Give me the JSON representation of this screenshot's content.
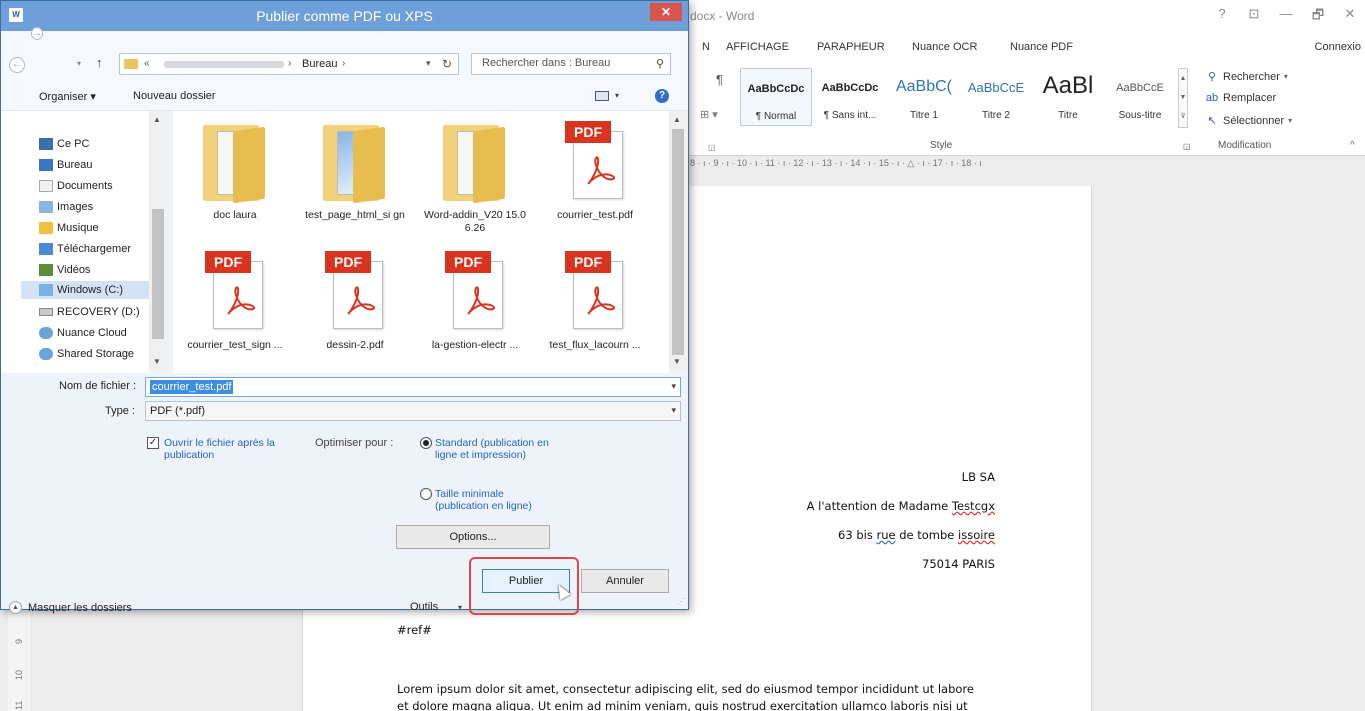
{
  "word": {
    "title": "docx - Word",
    "window_controls": [
      "?",
      "⊡",
      "—",
      "🗗",
      "✕"
    ],
    "tabs": [
      "N",
      "AFFICHAGE",
      "PARAPHEUR",
      "Nuance OCR",
      "Nuance PDF"
    ],
    "connexion": "Connexio",
    "paragraph_mark": "¶",
    "styles": [
      {
        "preview": "AaBbCcDc",
        "name": "¶ Normal"
      },
      {
        "preview": "AaBbCcDc",
        "name": "¶ Sans int..."
      },
      {
        "preview": "AaBbC(",
        "name": "Titre 1"
      },
      {
        "preview": "AaBbCcE",
        "name": "Titre 2"
      },
      {
        "preview": "AaBl",
        "name": "Titre"
      },
      {
        "preview": "AaBbCcE",
        "name": "Sous-titre"
      }
    ],
    "style_group_label": "Style",
    "modification": {
      "rechercher": "Rechercher",
      "remplacer": "Remplacer",
      "selectionner": "Sélectionner",
      "group_label": "Modification"
    },
    "ruler": "8 · ı · 9 · ı · 10 · ı · 11 · ı · 12 · ı · 13 · ı · 14 · ı · 15 · ı · △ · ı · 17 · ı · 18 · ı",
    "vruler": [
      "9",
      "10",
      "11"
    ],
    "document": {
      "company": "LB SA",
      "attention_prefix": "A l'attention de Madame ",
      "attention_name": "Testcgx",
      "addr_num": "63 bis ",
      "addr_rue": "rue",
      "addr_mid": " de tombe ",
      "addr_issoire": "issoire",
      "city": "75014 PARIS",
      "ref": "#ref#",
      "lorem1": "Lorem ipsum dolor sit amet, consectetur adipiscing elit, sed do eiusmod tempor incididunt ut labore",
      "lorem2": "et dolore magna aliqua. Ut enim ad minim veniam, quis nostrud exercitation ullamco laboris nisi ut"
    }
  },
  "dialog": {
    "title": "Publier comme PDF ou XPS",
    "close": "✕",
    "address": {
      "chevron": "«",
      "folder": "Bureau",
      "sep": "›"
    },
    "search_placeholder": "Rechercher dans : Bureau",
    "toolbar": {
      "organiser": "Organiser ▾",
      "nouveau_dossier": "Nouveau dossier",
      "help": "?"
    },
    "nav_items": [
      {
        "label": "Ce PC",
        "icon": "computer-icon"
      },
      {
        "label": "Bureau",
        "icon": "desktop-icon"
      },
      {
        "label": "Documents",
        "icon": "documents-icon"
      },
      {
        "label": "Images",
        "icon": "images-icon"
      },
      {
        "label": "Musique",
        "icon": "music-icon"
      },
      {
        "label": "Téléchargemer",
        "icon": "downloads-icon"
      },
      {
        "label": "Vidéos",
        "icon": "videos-icon"
      },
      {
        "label": "Windows (C:)",
        "icon": "windows-drive-icon"
      },
      {
        "label": "RECOVERY (D:)",
        "icon": "drive-icon"
      },
      {
        "label": "Nuance Cloud",
        "icon": "cloud-icon"
      },
      {
        "label": "Shared Storage",
        "icon": "network-storage-icon"
      }
    ],
    "files": [
      {
        "name": "doc laura",
        "type": "folder"
      },
      {
        "name": "test_page_html_si gn",
        "type": "folder"
      },
      {
        "name": "Word-addin_V20 15.06.26",
        "type": "folder"
      },
      {
        "name": "courrier_test.pdf",
        "type": "pdf"
      },
      {
        "name": "courrier_test_sign ...",
        "type": "pdf"
      },
      {
        "name": "dessin-2.pdf",
        "type": "pdf"
      },
      {
        "name": "la-gestion-electr ...",
        "type": "pdf"
      },
      {
        "name": "test_flux_lacourn ...",
        "type": "pdf"
      }
    ],
    "pdf_badge": "PDF",
    "filename_label": "Nom de fichier :",
    "filename_value": "courrier_test.pdf",
    "type_label": "Type :",
    "type_value": "PDF (*.pdf)",
    "open_after_label": "Ouvrir le fichier après la publication",
    "optimize_label": "Optimiser pour :",
    "opt_standard": "Standard (publication en ligne et impression)",
    "opt_minimal": "Taille minimale (publication en ligne)",
    "options_button": "Options...",
    "hide_folders": "Masquer les dossiers",
    "tools": "Outils",
    "publish": "Publier",
    "cancel": "Annuler"
  }
}
